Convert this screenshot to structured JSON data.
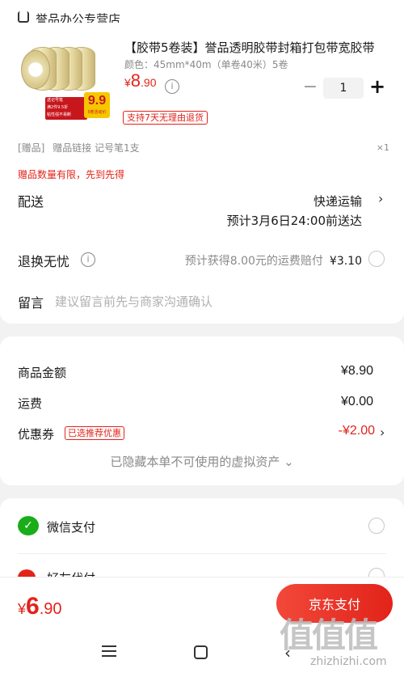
{
  "store": {
    "name": "誉品办公专营店"
  },
  "product": {
    "title": "【胶带5卷装】誉品透明胶带封箱打包带宽胶带",
    "spec": "颜色：45mm*40m（单卷40米）5卷",
    "price_currency": "¥",
    "price_int": "8",
    "price_dec": ".90",
    "quantity": "1",
    "return_tag": "支持7天无理由退货",
    "image_badges": {
      "left_lines": [
        "送记号笔",
        "满2件9.5折",
        "粘性强不易断"
      ],
      "promo_value": "9.9",
      "promo_caption": "5卷活动价"
    }
  },
  "gift": {
    "tag": "[赠品]",
    "description": "赠品链接 记号笔1支",
    "quantity": "×1",
    "warning": "赠品数量有限，先到先得"
  },
  "delivery": {
    "label": "配送",
    "method": "快递运输",
    "eta": "预计3月6日24:00前送达"
  },
  "return_service": {
    "label": "退换无忧",
    "description": "预计获得8.00元的运费赔付",
    "price": "¥3.10"
  },
  "note": {
    "label": "留言",
    "placeholder": "建议留言前先与商家沟通确认"
  },
  "summary": {
    "goods_label": "商品金额",
    "goods_value": "¥8.90",
    "shipping_label": "运费",
    "shipping_value": "¥0.00",
    "coupon_label": "优惠券",
    "coupon_tag": "已选推荐优惠",
    "coupon_value": "-¥2.00",
    "hidden_assets": "已隐藏本单不可使用的虚拟资产 ⌄"
  },
  "payment": {
    "wechat_label": "微信支付",
    "friend_label": "好友代付"
  },
  "footer": {
    "total_currency": "¥",
    "total_int": "6",
    "total_dec": ".90",
    "pay_button": "京东支付"
  },
  "watermark": {
    "logo": "值值值",
    "url": "zhizhizhi.com"
  }
}
